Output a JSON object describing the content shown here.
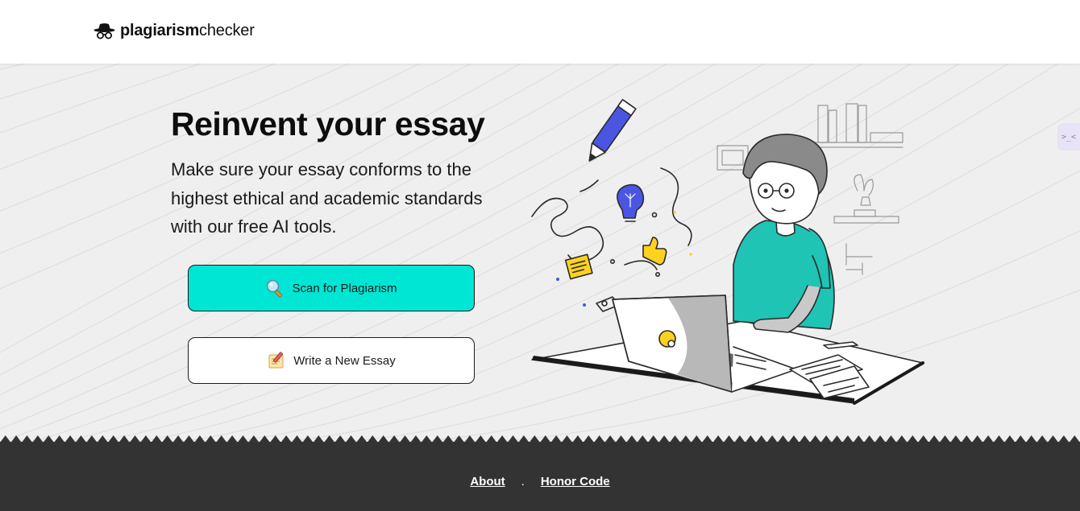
{
  "header": {
    "brand_bold": "plagiarism",
    "brand_light": "checker",
    "logo_icon": "spy-hat-glasses-icon"
  },
  "hero": {
    "title": "Reinvent your essay",
    "lead": "Make sure your essay conforms to the highest ethical and academic standards with our free AI tools.",
    "buttons": [
      {
        "label": "Scan for Plagiarism",
        "icon": "magnifier-icon",
        "bg": "#00e6d5"
      },
      {
        "label": "Write a New Essay",
        "icon": "paper-pencil-icon",
        "bg": "#ffffff"
      }
    ],
    "illustration": "student-laptop-illustration"
  },
  "side_tab": {
    "icon": "code-face-icon",
    "text": ">_<"
  },
  "footer": {
    "links": [
      {
        "label": "About"
      },
      {
        "label": "Honor Code"
      }
    ],
    "separator": "."
  },
  "colors": {
    "accent": "#00e6d5",
    "footer_bg": "#333333",
    "hero_bg": "#efefef",
    "shirt": "#1fc4b4",
    "highlight_yellow": "#ffd21f",
    "blue": "#4a56e2"
  }
}
